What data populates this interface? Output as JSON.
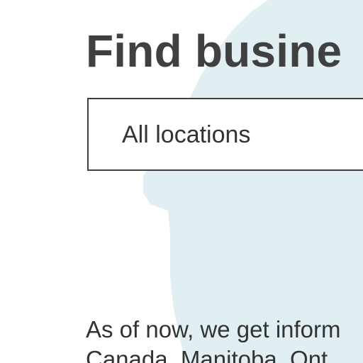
{
  "header": {
    "title": "Find busine"
  },
  "location_filter": {
    "selected": "All locations"
  },
  "info": {
    "line1": "As of now, we get inform",
    "line2": "Canada, Manitoba, Ont"
  },
  "colors": {
    "map_fill": "#e1eff2",
    "text": "#404040",
    "border": "#404040"
  },
  "icons": {
    "background": "canada-map-icon"
  }
}
